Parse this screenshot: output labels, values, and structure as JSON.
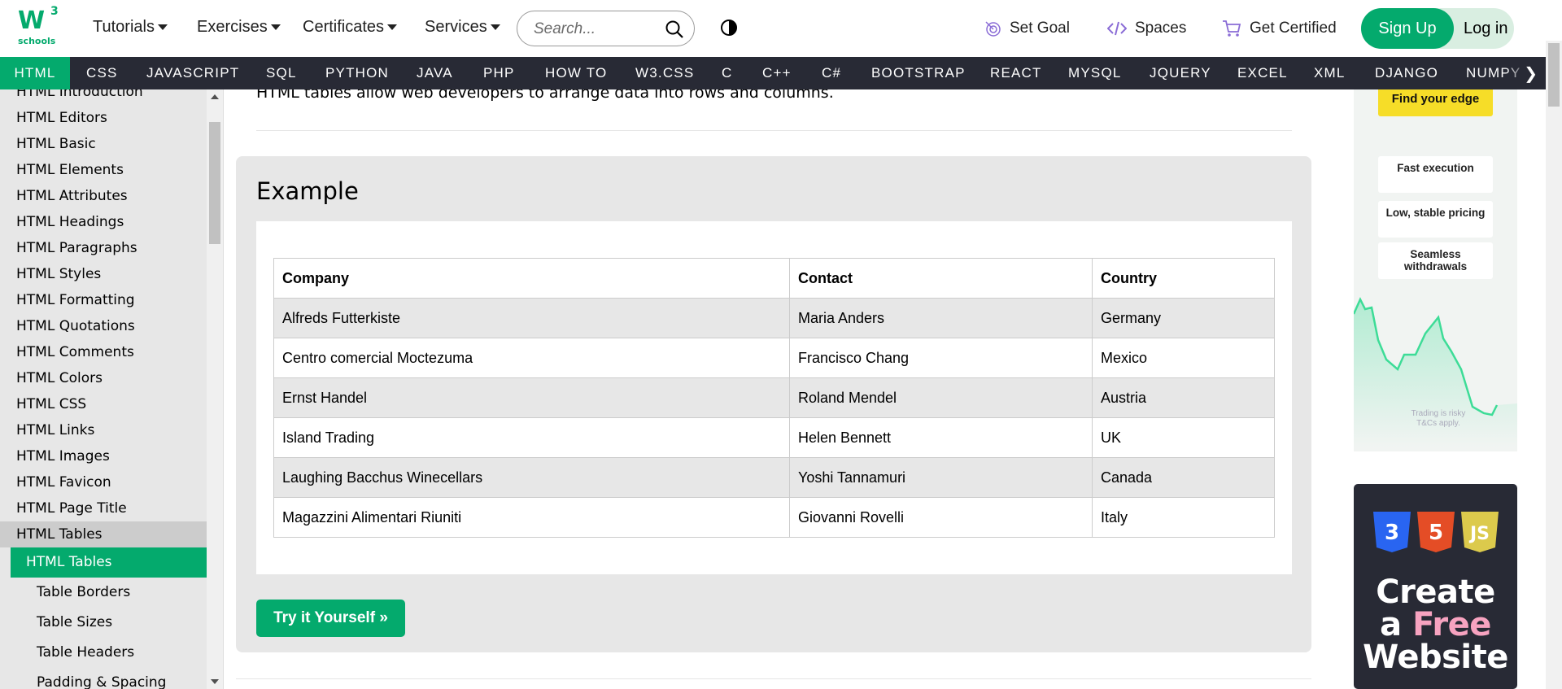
{
  "header": {
    "logo": "w3schools",
    "nav": [
      {
        "label": "Tutorials"
      },
      {
        "label": "Exercises"
      },
      {
        "label": "Certificates"
      },
      {
        "label": "Services"
      }
    ],
    "search_placeholder": "Search...",
    "set_goal": "Set Goal",
    "spaces": "Spaces",
    "get_certified": "Get Certified",
    "sign_up": "Sign Up",
    "log_in": "Log in"
  },
  "subjects": [
    "HTML",
    "CSS",
    "JAVASCRIPT",
    "SQL",
    "PYTHON",
    "JAVA",
    "PHP",
    "HOW TO",
    "W3.CSS",
    "C",
    "C++",
    "C#",
    "BOOTSTRAP",
    "REACT",
    "MYSQL",
    "JQUERY",
    "EXCEL",
    "XML",
    "DJANGO",
    "NUMPY"
  ],
  "sidebar": {
    "items": [
      "HTML Introduction",
      "HTML Editors",
      "HTML Basic",
      "HTML Elements",
      "HTML Attributes",
      "HTML Headings",
      "HTML Paragraphs",
      "HTML Styles",
      "HTML Formatting",
      "HTML Quotations",
      "HTML Comments",
      "HTML Colors",
      "HTML CSS",
      "HTML Links",
      "HTML Images",
      "HTML Favicon",
      "HTML Page Title"
    ],
    "group": "HTML Tables",
    "subitems": [
      "HTML Tables",
      "Table Borders",
      "Table Sizes",
      "Table Headers",
      "Padding & Spacing"
    ]
  },
  "main": {
    "intro": "HTML tables allow web developers to arrange data into rows and columns.",
    "example_title": "Example",
    "table": {
      "headers": [
        "Company",
        "Contact",
        "Country"
      ],
      "rows": [
        [
          "Alfreds Futterkiste",
          "Maria Anders",
          "Germany"
        ],
        [
          "Centro comercial Moctezuma",
          "Francisco Chang",
          "Mexico"
        ],
        [
          "Ernst Handel",
          "Roland Mendel",
          "Austria"
        ],
        [
          "Island Trading",
          "Helen Bennett",
          "UK"
        ],
        [
          "Laughing Bacchus Winecellars",
          "Yoshi Tannamuri",
          "Canada"
        ],
        [
          "Magazzini Alimentari Riuniti",
          "Giovanni Rovelli",
          "Italy"
        ]
      ]
    },
    "try_it": "Try it Yourself »"
  },
  "ads": {
    "ad1": {
      "button": "Find your edge",
      "cards": [
        "Fast execution",
        "Low, stable pricing",
        "Seamless withdrawals"
      ],
      "risk": "Trading is risky T&Cs apply."
    },
    "ad2": {
      "line1": "Create",
      "line2a": "a ",
      "line2b": "Free",
      "line3": "Website"
    }
  },
  "colors": {
    "brand_green": "#04aa6d",
    "subject_bar": "#282a35",
    "sidebar_bg": "#e7e7e7"
  }
}
